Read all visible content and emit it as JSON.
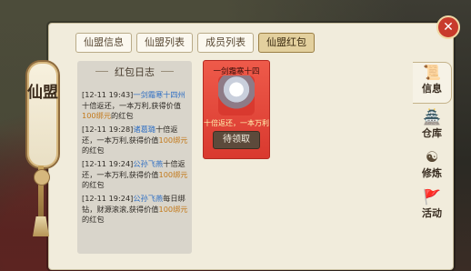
{
  "side_banner": {
    "label": "仙盟"
  },
  "tabs": [
    {
      "label": "仙盟信息",
      "active": false
    },
    {
      "label": "仙盟列表",
      "active": false
    },
    {
      "label": "成员列表",
      "active": false
    },
    {
      "label": "仙盟红包",
      "active": true
    }
  ],
  "log": {
    "title": "红包日志",
    "entries": [
      {
        "time": "[12-11 19:43]",
        "name": "一剑霜寒十四州",
        "text": "十倍返还，一本万利,获得价值",
        "amount": "100绑元",
        "suffix": "的红包"
      },
      {
        "time": "[12-11 19:28]",
        "name": "诸葛璐",
        "text": "十倍返还，一本万利,获得价值",
        "amount": "100绑元",
        "suffix": "的红包"
      },
      {
        "time": "[12-11 19:24]",
        "name": "公孙飞燕",
        "text": "十倍返还，一本万利,获得价值",
        "amount": "100绑元",
        "suffix": "的红包"
      },
      {
        "time": "[12-11 19:24]",
        "name": "公孙飞燕",
        "text": "每日绑钻，财源滚滚,获得价值",
        "amount": "100绑元",
        "suffix": "的红包"
      }
    ]
  },
  "red_packet": {
    "sender": "一剑霜寒十四",
    "desc": "十倍返还，一本万利",
    "button": "待领取"
  },
  "side_tabs": [
    {
      "icon": "info-icon",
      "glyph": "📜",
      "label": "信息",
      "active": true
    },
    {
      "icon": "warehouse-icon",
      "glyph": "🏯",
      "label": "仓库",
      "active": false
    },
    {
      "icon": "cultivate-icon",
      "glyph": "☯",
      "label": "修炼",
      "active": false
    },
    {
      "icon": "activity-icon",
      "glyph": "🚩",
      "label": "活动",
      "active": false
    }
  ],
  "colors": {
    "accent": "#e3d09e",
    "packet": "#e04a3d",
    "name_link": "#2f6fc4",
    "gold": "#c37a1c"
  }
}
